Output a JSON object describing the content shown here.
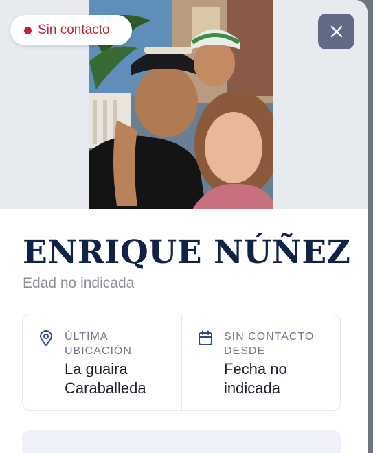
{
  "status": {
    "label": "Sin contacto",
    "color": "#c8203a"
  },
  "close_button": {
    "icon": "close-icon"
  },
  "person": {
    "name": "ENRIQUE NÚÑEZ",
    "age": "Edad no indicada"
  },
  "info": [
    {
      "icon": "location-pin-icon",
      "label": "ÚLTIMA UBICACIÓN",
      "value": "La guaira Caraballeda"
    },
    {
      "icon": "calendar-icon",
      "label": "SIN CONTACTO DESDE",
      "value": "Fecha no indicada"
    }
  ],
  "colors": {
    "accent": "#102248",
    "close_bg": "#5e6c85",
    "icon": "#2f4a8a"
  }
}
